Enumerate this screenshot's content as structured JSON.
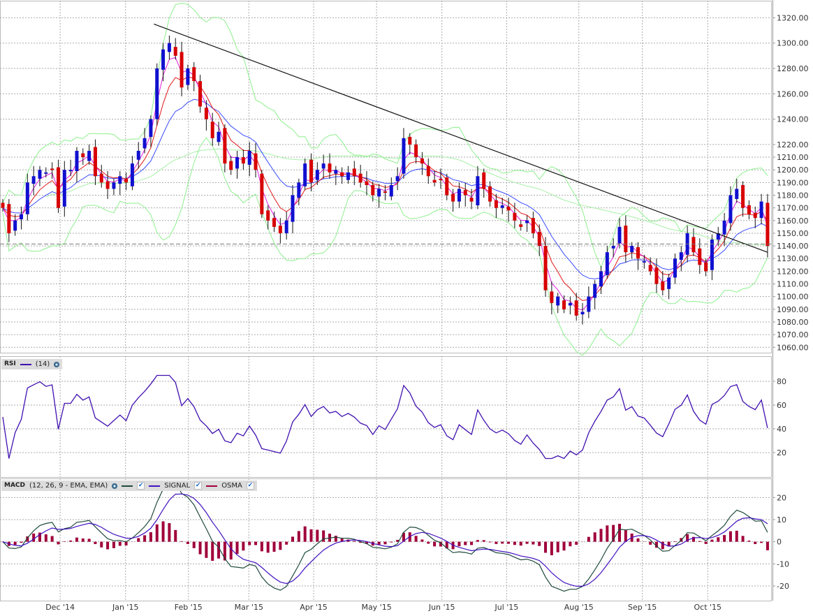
{
  "chart_data": [
    {
      "type": "candlestick",
      "name": "price",
      "ylim": [
        1050,
        1330
      ],
      "yticks": [
        1320,
        1300,
        1280,
        1260,
        1240,
        1220,
        1210,
        1200,
        1190,
        1180,
        1170,
        1160,
        1150,
        1140,
        1130,
        1120,
        1110,
        1100,
        1090,
        1080,
        1070,
        1060
      ],
      "ytick_format": "2dp",
      "last_price_line": 1141.5,
      "trendline": {
        "from": {
          "index": 24.5,
          "value": 1315
        },
        "to": {
          "index": 124,
          "value": 1135
        }
      },
      "closes": [
        1170,
        1150,
        1160,
        1165,
        1190,
        1195,
        1200,
        1198,
        1200,
        1170,
        1200,
        1200,
        1215,
        1210,
        1215,
        1195,
        1190,
        1185,
        1190,
        1195,
        1190,
        1205,
        1215,
        1225,
        1240,
        1280,
        1295,
        1300,
        1290,
        1265,
        1280,
        1270,
        1250,
        1240,
        1225,
        1230,
        1205,
        1200,
        1210,
        1205,
        1215,
        1200,
        1165,
        1160,
        1155,
        1150,
        1160,
        1180,
        1190,
        1205,
        1190,
        1200,
        1205,
        1198,
        1200,
        1195,
        1198,
        1195,
        1190,
        1188,
        1180,
        1185,
        1182,
        1188,
        1195,
        1225,
        1220,
        1210,
        1205,
        1195,
        1190,
        1192,
        1180,
        1175,
        1185,
        1180,
        1175,
        1195,
        1185,
        1175,
        1170,
        1172,
        1168,
        1160,
        1155,
        1160,
        1150,
        1140,
        1105,
        1095,
        1100,
        1090,
        1095,
        1085,
        1088,
        1100,
        1110,
        1120,
        1135,
        1140,
        1155,
        1135,
        1140,
        1130,
        1128,
        1120,
        1110,
        1105,
        1115,
        1130,
        1135,
        1150,
        1135,
        1125,
        1120,
        1145,
        1150,
        1160,
        1180,
        1185,
        1170,
        1165,
        1162,
        1175,
        1140
      ],
      "overlays": {
        "bollinger_color": "#8ef08e",
        "long_ma_color": "#a8f0a8",
        "fast_ma_color": "#e020e0",
        "mid_ma_color": "#e01818",
        "slow_ma_color": "#3a4cff"
      },
      "up_color": "#1010d0",
      "down_color": "#d80000"
    },
    {
      "type": "line",
      "name": "rsi",
      "label": "RSI",
      "param": "(14)",
      "ylim": [
        0,
        100
      ],
      "yticks": [
        80,
        60,
        40,
        20
      ],
      "color": "#4010b0"
    },
    {
      "type": "macd",
      "name": "macd",
      "label": "MACD",
      "param": "(12, 26, 9 - EMA, EMA)",
      "legend": [
        "SIGNAL",
        "OSMA"
      ],
      "ylim": [
        -26,
        28
      ],
      "yticks": [
        20,
        10,
        0,
        -10,
        -20
      ],
      "macd_color": "#1f4a3a",
      "signal_color": "#4010c0",
      "osma_color": "#a0003a"
    }
  ],
  "xaxis": {
    "labels": [
      {
        "text": "Dec '14",
        "index": 9.3
      },
      {
        "text": "Jan '15",
        "index": 19.9
      },
      {
        "text": "Feb '15",
        "index": 30.1
      },
      {
        "text": "Mar '15",
        "index": 39.9
      },
      {
        "text": "Apr '15",
        "index": 50.4
      },
      {
        "text": "May '15",
        "index": 60.6
      },
      {
        "text": "Jun '15",
        "index": 71.2
      },
      {
        "text": "Jul '15",
        "index": 81.7
      },
      {
        "text": "Aug '15",
        "index": 93.4
      },
      {
        "text": "Sep '15",
        "index": 103.7
      },
      {
        "text": "Oct '15",
        "index": 114.3
      }
    ]
  },
  "legends": {
    "rsi_label": "RSI",
    "rsi_param": "(14)",
    "macd_label": "MACD",
    "macd_param": "(12, 26, 9 - EMA, EMA)",
    "signal_label": "SIGNAL",
    "osma_label": "OSMA",
    "check": "✔"
  }
}
